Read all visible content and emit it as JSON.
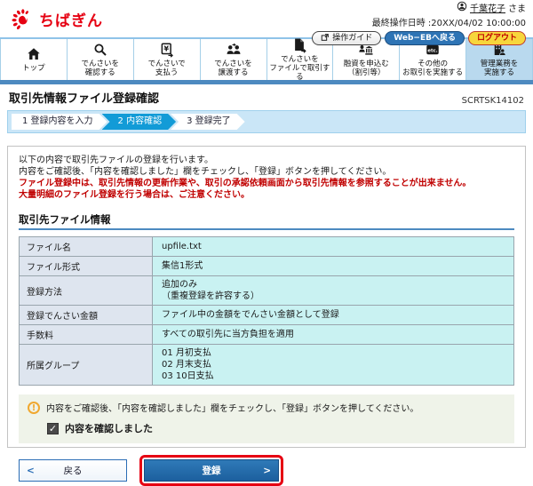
{
  "header": {
    "logo_text": "ちばぎん",
    "user_name": "千葉花子",
    "user_suffix": "さま",
    "last_operation": "最終操作日時 :20XX/04/02 10:00:00",
    "buttons": {
      "guide": "操作ガイド",
      "web_eb": "Web−EBへ戻る",
      "logout": "ログアウト"
    }
  },
  "nav": {
    "items": [
      {
        "label": "トップ",
        "icon": "home-icon"
      },
      {
        "label": "でんさいを\n確認する",
        "icon": "search-icon"
      },
      {
        "label": "でんさいで\n支払う",
        "icon": "pay-icon"
      },
      {
        "label": "でんさいを\n譲渡する",
        "icon": "transfer-icon"
      },
      {
        "label": "でんさいを\nファイルで取引する",
        "icon": "file-icon"
      },
      {
        "label": "融資を申込む\n（割引等）",
        "icon": "loan-icon"
      },
      {
        "label": "その他の\nお取引を実施する",
        "icon": "etc-icon"
      },
      {
        "label": "管理業務を\n実施する",
        "icon": "admin-icon"
      }
    ]
  },
  "page": {
    "title": "取引先情報ファイル登録確認",
    "screen_id": "SCRTSK14102"
  },
  "steps": {
    "items": [
      {
        "label": "1 登録内容を入力",
        "active": false
      },
      {
        "label": "2 内容確認",
        "active": true
      },
      {
        "label": "3 登録完了",
        "active": false
      }
    ]
  },
  "instructions": {
    "line1": "以下の内容で取引先ファイルの登録を行います。",
    "line2": "内容をご確認後、「内容を確認しました」欄をチェックし、「登録」ボタンを押してください。",
    "warning1": "ファイル登録中は、取引先情報の更新作業や、取引の承認依頼画面から取引先情報を参照することが出来ません。",
    "warning2": "大量明細のファイル登録を行う場合は、ご注意ください。"
  },
  "file_info": {
    "section_title": "取引先ファイル情報",
    "rows": [
      {
        "label": "ファイル名",
        "value": "upfile.txt"
      },
      {
        "label": "ファイル形式",
        "value": "集信1形式"
      },
      {
        "label": "登録方法",
        "value": "追加のみ\n（重複登録を許容する）"
      },
      {
        "label": "登録でんさい金額",
        "value": "ファイル中の金額をでんさい金額として登録"
      },
      {
        "label": "手数料",
        "value": "すべての取引先に当方負担を適用"
      },
      {
        "label": "所属グループ",
        "value": "01 月初支払\n02 月末支払\n03 10日支払"
      }
    ]
  },
  "confirm": {
    "notice": "内容をご確認後、「内容を確認しました」欄をチェックし、「登録」ボタンを押してください。",
    "checkbox_label": "内容を確認しました",
    "checkbox_checked": true,
    "check_glyph": "✓",
    "warning_glyph": "!"
  },
  "footer": {
    "back_label": "戻る",
    "submit_label": "登録",
    "chevron_left": "<",
    "chevron_right": ">"
  },
  "colors": {
    "brand_red": "#e60012",
    "accent_blue": "#2e74b5",
    "nav_bar_blue": "#4d8ac0",
    "step_active_blue": "#129bd7",
    "label_cell_bg": "#dee5ef",
    "value_cell_bg": "#c9f2f2",
    "logout_yellow": "#f7d63c",
    "highlight_red": "#e60012"
  }
}
